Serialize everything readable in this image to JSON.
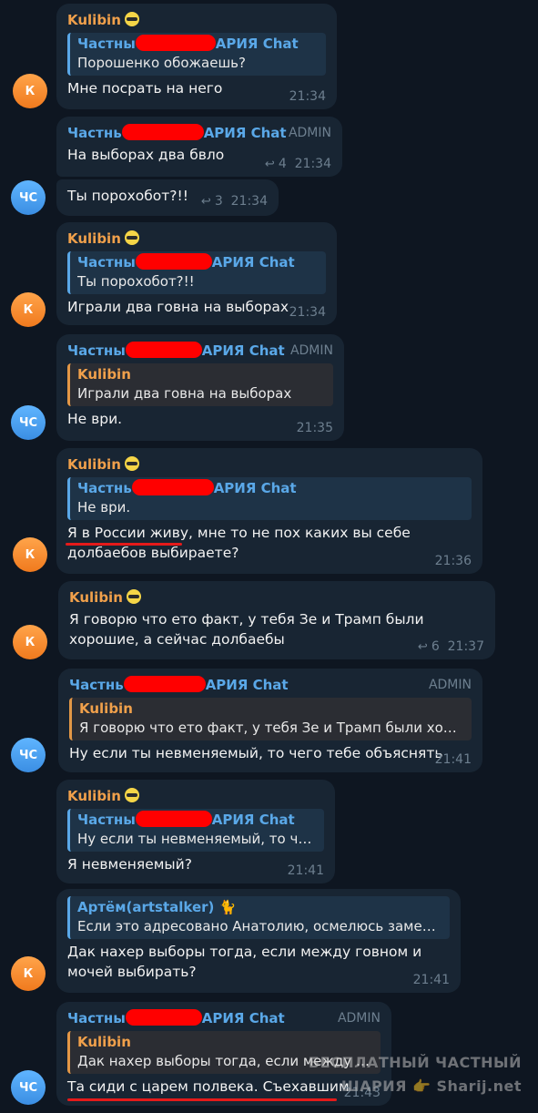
{
  "chat_name_left": "Частны",
  "chat_name_right": "АРИЯ Chat",
  "chat_name_left_alt": "Частнь",
  "admin_label": "ADMIN",
  "avatar_k": "К",
  "avatar_cs": "ЧС",
  "kulibin": "Kulibin",
  "artem": "Артём(artstalker)",
  "msgs": {
    "m1": {
      "quote": "Порошенко обожаешь?",
      "text": "Мне посрать на него",
      "time": "21:34"
    },
    "m2": {
      "text": "На выборах два бвло",
      "replies": "4",
      "time": "21:34"
    },
    "m3": {
      "text": "Ты порохобот?!!",
      "replies": "3",
      "time": "21:34"
    },
    "m4": {
      "quote": "Ты порохобот?!!",
      "text": "Играли два говна на выборах",
      "time": "21:34"
    },
    "m5": {
      "quote": "Играли два говна на выборах",
      "text": "Не ври.",
      "time": "21:35"
    },
    "m6": {
      "quote": "Не ври.",
      "text": "Я в России живу, мне то не пох каких вы себе долбаебов выбираете?",
      "time": "21:36"
    },
    "m7": {
      "text": "Я говорю что ето факт, у тебя Зе и Трамп были хорошие, а сейчас долбаебы",
      "replies": "6",
      "time": "21:37"
    },
    "m8": {
      "quote": "Я говорю что ето факт, у тебя Зе и Трамп были хоро...",
      "text": "Ну если ты невменяемый, то чего тебе объяснять",
      "time": "21:41"
    },
    "m9": {
      "quote": "Ну если ты невменяемый, то че...",
      "text": "Я невменяемый?",
      "time": "21:41"
    },
    "m10": {
      "quote": "Если это адресовано Анатолию, осмелюсь замет...",
      "text": "Дак нахер выборы тогда, если между говном и мочей выбирать?",
      "time": "21:41"
    },
    "m11": {
      "quote": "Дак нахер выборы тогда, если между го...",
      "text": "Та сиди с царем полвека. Съехавшим",
      "time": "21:43"
    }
  },
  "watermark": {
    "line1": "БЕСПЛАТНЫЙ ЧАСТНЫЙ",
    "line2": "ШАРИЯ 👉 Sharij.net"
  },
  "colors": {
    "bg": "#0e1621",
    "bubble": "#182533",
    "name_kulibin": "#f0a04b",
    "name_chat": "#5aa8e8",
    "redaction": "#ff0000",
    "underline": "#e51a1a"
  }
}
